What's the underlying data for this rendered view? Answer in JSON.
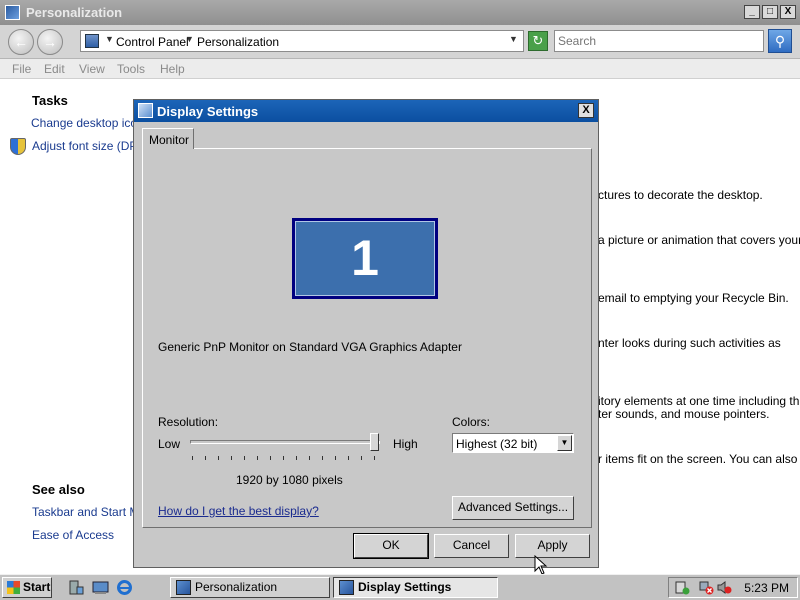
{
  "window": {
    "title": "Personalization",
    "controls": {
      "minimize": "_",
      "maximize": "□",
      "close": "X"
    }
  },
  "address": {
    "back_icon": "back-arrow-icon",
    "forward_icon": "forward-arrow-icon",
    "crumbs": [
      "Control Panel",
      "Personalization"
    ],
    "search_placeholder": "Search"
  },
  "menu": [
    "File",
    "Edit",
    "View",
    "Tools",
    "Help"
  ],
  "tasks": {
    "heading": "Tasks",
    "links": [
      "Change desktop icons",
      "Adjust font size (DPI)"
    ]
  },
  "background_text": [
    "ctures to decorate the desktop.",
    "a picture or animation that covers your",
    "email to emptying your Recycle Bin.",
    "nter looks during such activities as",
    "itory elements at one time including the",
    "ter sounds, and mouse pointers.",
    "r items fit on the screen. You can also"
  ],
  "see_also": {
    "heading": "See also",
    "links": [
      "Taskbar and Start Menu",
      "Ease of Access"
    ]
  },
  "dialog": {
    "title": "Display Settings",
    "close": "X",
    "tab": "Monitor",
    "monitor_number": "1",
    "monitor_description": "Generic PnP Monitor on Standard VGA Graphics Adapter",
    "resolution_label": "Resolution:",
    "low_label": "Low",
    "high_label": "High",
    "resolution_level": 1.0,
    "resolution_value": "1920 by 1080 pixels",
    "colors_label": "Colors:",
    "colors_value": "Highest (32 bit)",
    "help_link": "How do I get the best display?",
    "advanced_button": "Advanced Settings...",
    "ok_button": "OK",
    "cancel_button": "Cancel",
    "apply_button": "Apply"
  },
  "taskbar": {
    "start_label": "Start",
    "tasks": [
      "Personalization",
      "Display Settings"
    ],
    "active_task": "Display Settings",
    "clock": "5:23 PM"
  }
}
